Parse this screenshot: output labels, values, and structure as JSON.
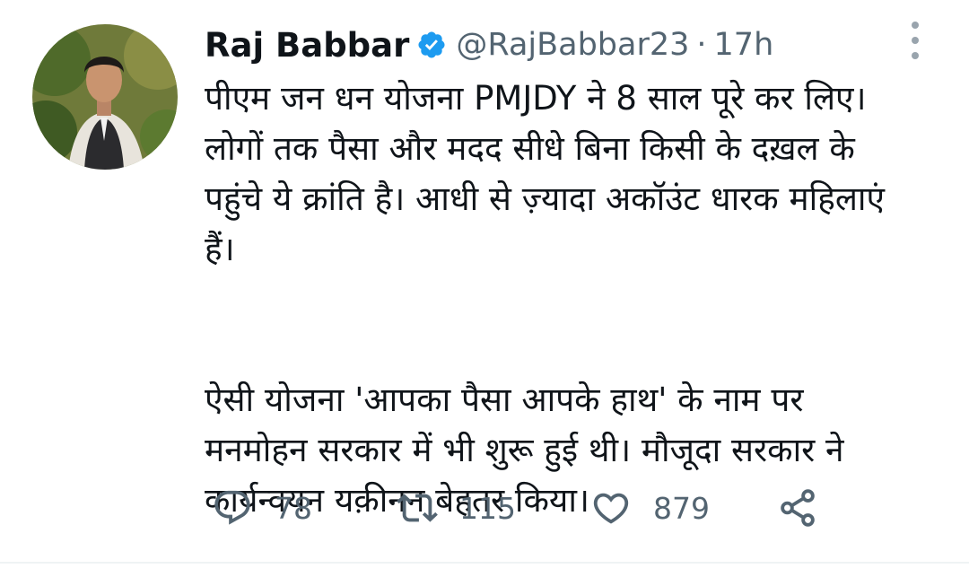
{
  "tweet": {
    "author": {
      "name": "Raj Babbar",
      "handle": "@RajBabbar23",
      "verified": true,
      "avatar": "profile-photo"
    },
    "separator": "·",
    "time": "17h",
    "body": {
      "paragraph_1": {
        "line_1": "पीएम जन धन योजना PMJDY ने 8 साल पूरे कर लिए।",
        "line_2": "लोगों तक पैसा और मदद सीधे बिना किसी के दख़ल के",
        "line_3": "पहुंचे ये क्रांति है। आधी से ज़्यादा अकॉउंट धारक महिलाएं",
        "line_4": "हैं।"
      },
      "paragraph_2": {
        "line_1": "ऐसी योजना 'आपका पैसा आपके हाथ' के नाम पर",
        "line_2": "मनमोहन  सरकार में भी शुरू हुई थी। मौजूदा सरकार ने",
        "line_3": "कार्यन्वयन यक़ीनन बेहतर किया।"
      }
    },
    "actions": {
      "reply": {
        "icon": "reply-icon",
        "count": "78"
      },
      "retweet": {
        "icon": "retweet-icon",
        "count": "115"
      },
      "like": {
        "icon": "heart-icon",
        "count": "879"
      },
      "share": {
        "icon": "share-icon"
      }
    }
  },
  "colors": {
    "text": "#0f1419",
    "secondary": "#536471",
    "verified_badge": "#1d9bf0",
    "divider": "#eff3f4"
  }
}
